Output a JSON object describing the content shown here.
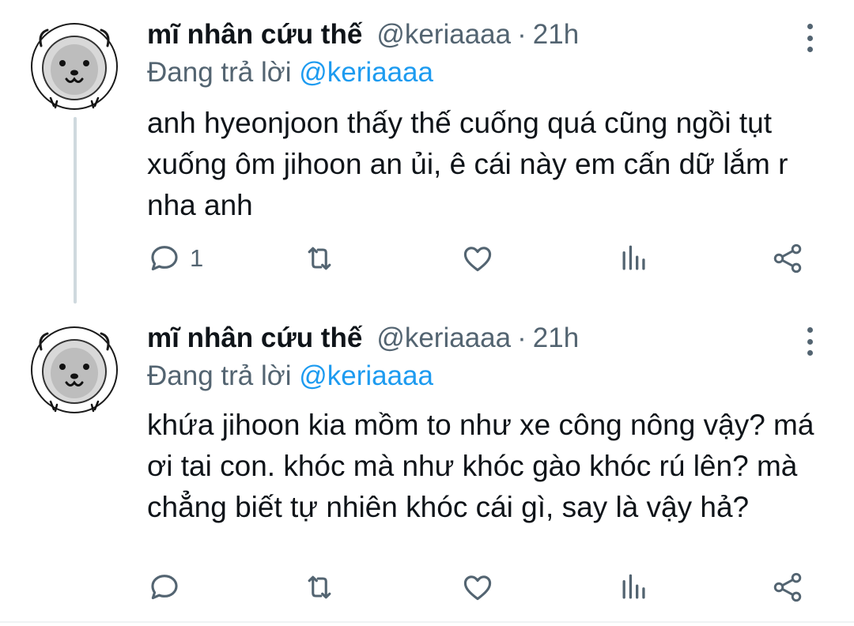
{
  "tweets": [
    {
      "display_name": "mĩ nhân cứu thế",
      "handle": "@keriaaaa",
      "dot": "·",
      "time": "21h",
      "reply_prefix": "Đang trả lời",
      "reply_to": "@keriaaaa",
      "text": "anh hyeonjoon thấy thế cuống quá cũng ngồi tụt xuống ôm jihoon an ủi, ê cái này em cấn dữ lắm r nha anh",
      "reply_count": "1",
      "icons": [
        "reply-icon",
        "retweet-icon",
        "like-icon",
        "views-icon",
        "share-icon"
      ]
    },
    {
      "display_name": "mĩ nhân cứu thế",
      "handle": "@keriaaaa",
      "dot": "·",
      "time": "21h",
      "reply_prefix": "Đang trả lời",
      "reply_to": "@keriaaaa",
      "text": "khứa jihoon kia mồm to như xe công nông vậy? má ơi tai con. khóc mà như khóc gào khóc rú lên? mà chẳng biết tự nhiên khóc cái gì, say là vậy hả?",
      "reply_count": "",
      "icons": [
        "reply-icon",
        "retweet-icon",
        "like-icon",
        "views-icon",
        "share-icon"
      ]
    }
  ],
  "colors": {
    "text": "#0f1419",
    "secondary": "#536471",
    "mention": "#1d9bf0",
    "thread_line": "#cfd9de"
  }
}
